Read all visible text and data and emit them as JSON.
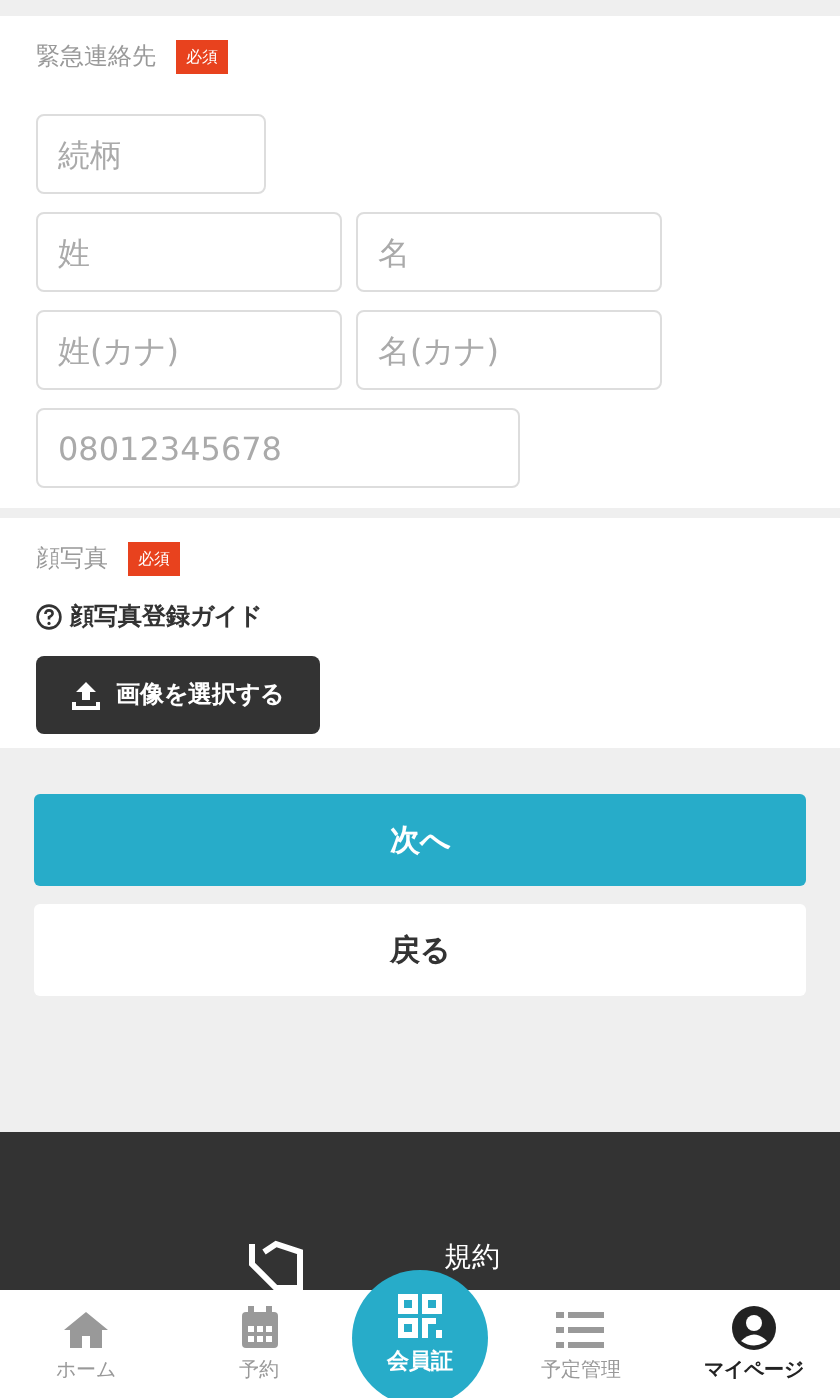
{
  "emergency_contact": {
    "label": "緊急連絡先",
    "badge": "必須",
    "field_rows": [
      [
        {
          "placeholder": "続柄"
        }
      ],
      [
        {
          "placeholder": "姓"
        },
        {
          "placeholder": "名"
        }
      ],
      [
        {
          "placeholder": "姓(カナ)"
        },
        {
          "placeholder": "名(カナ)"
        }
      ],
      [
        {
          "placeholder": "08012345678"
        }
      ]
    ]
  },
  "face_photo": {
    "label": "顔写真",
    "badge": "必須",
    "guide_link": "顔写真登録ガイド",
    "upload_button": "画像を選択する"
  },
  "actions": {
    "next": "次へ",
    "back": "戻る"
  },
  "footer": {
    "link": "規約"
  },
  "bottom_nav": [
    {
      "label": "ホーム",
      "selected": false
    },
    {
      "label": "予約",
      "selected": false
    },
    {
      "label": "会員証",
      "selected": false
    },
    {
      "label": "予定管理",
      "selected": false
    },
    {
      "label": "マイページ",
      "selected": true
    }
  ]
}
